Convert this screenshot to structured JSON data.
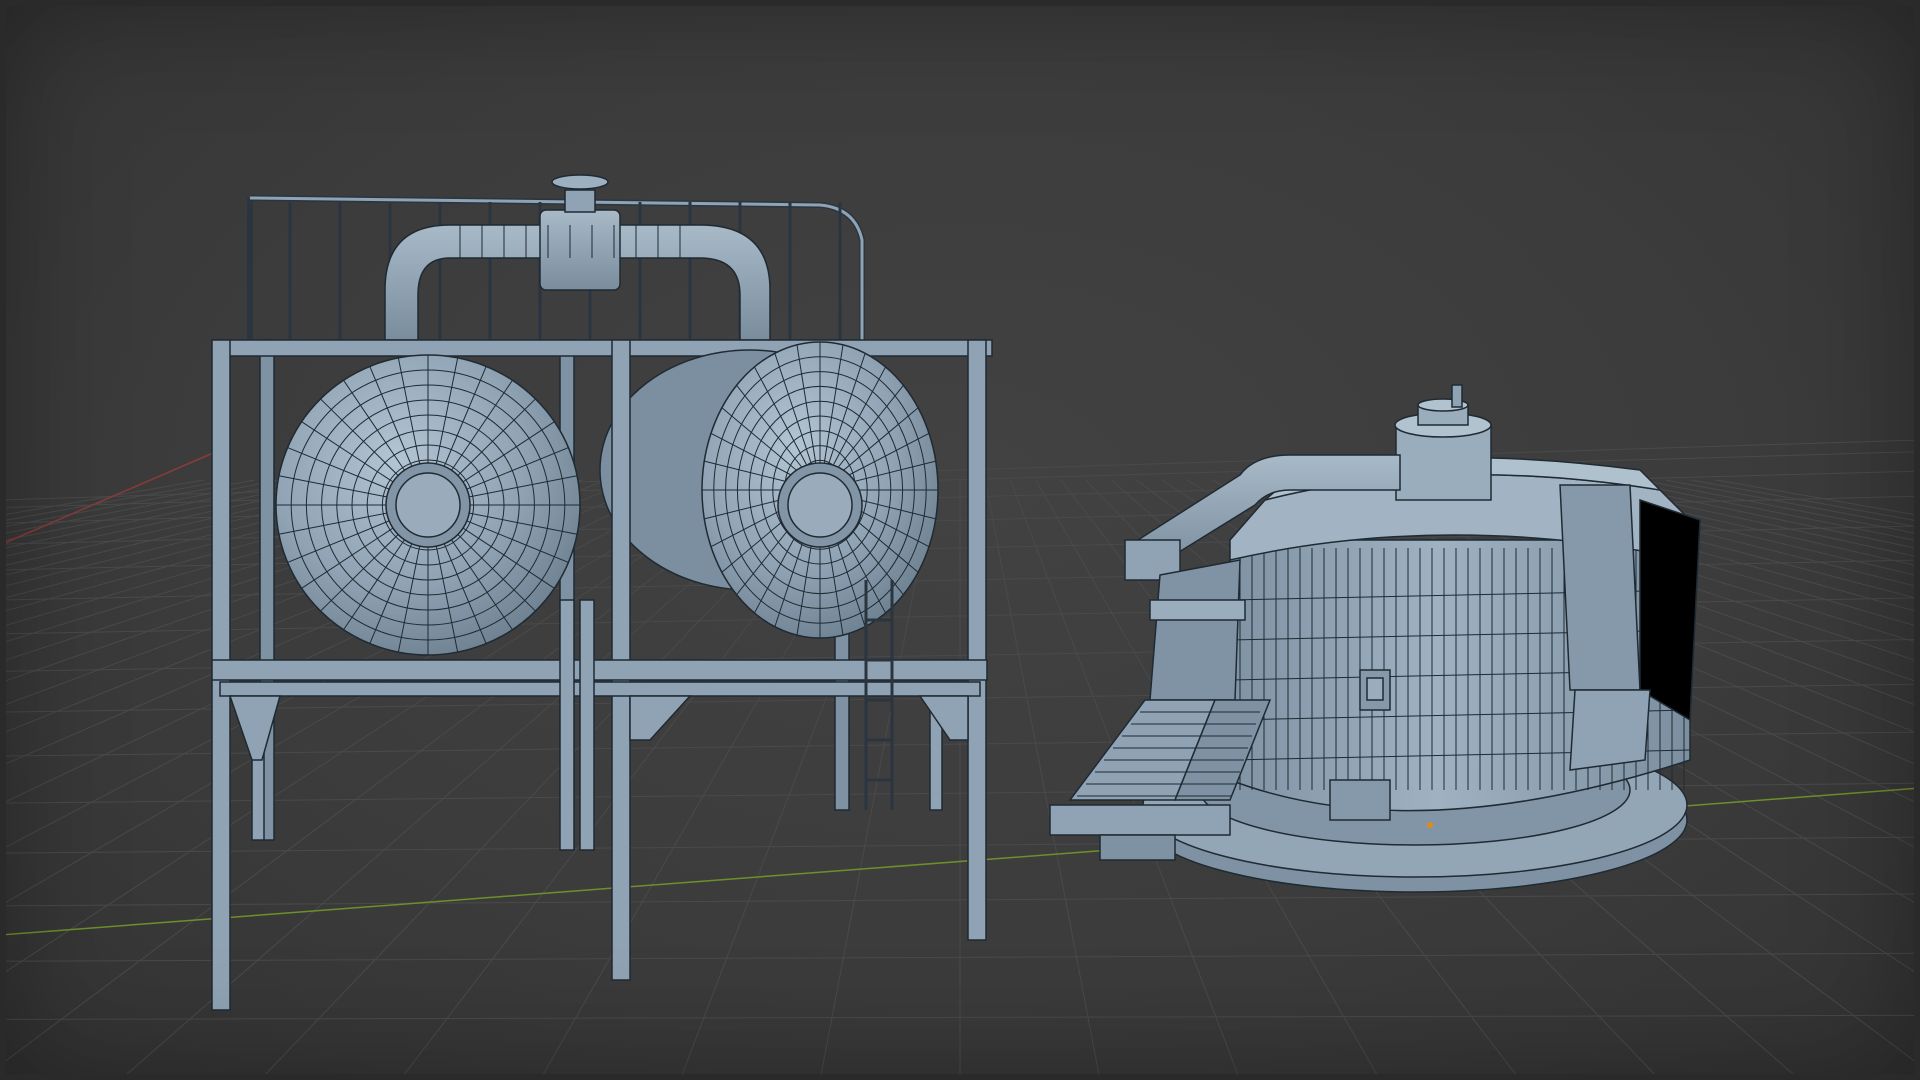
{
  "viewport": {
    "mode": "3D Viewport",
    "shading": "solid",
    "overlay": "wireframe",
    "background_color": "#3c3c3c",
    "grid_color": "#4a4a4a",
    "x_axis_color": "#8a3b3b",
    "y_axis_color": "#6f8f2a",
    "mesh_color": "#8fa3b4",
    "wire_color": "#1f2a33",
    "origin_color": "#e08a1e"
  },
  "scene": {
    "objects": [
      {
        "name": "tank-rack",
        "kind": "mesh"
      },
      {
        "name": "reactor-pod",
        "kind": "mesh"
      }
    ]
  }
}
